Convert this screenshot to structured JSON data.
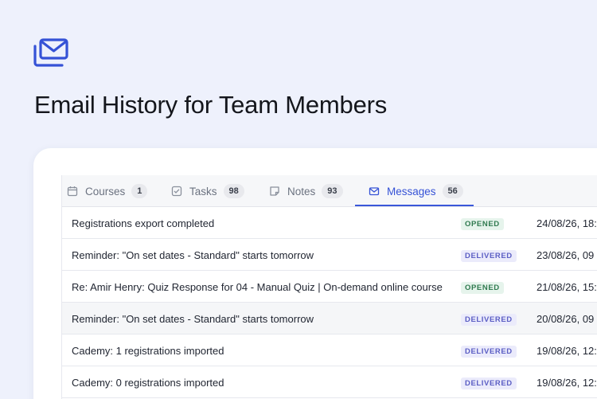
{
  "page": {
    "title": "Email History for Team Members",
    "icon": "mail-stack-icon",
    "accent": "#3a57d9"
  },
  "tabs": [
    {
      "label": "Courses",
      "count": "1",
      "icon": "calendar-icon"
    },
    {
      "label": "Tasks",
      "count": "98",
      "icon": "checkbox-icon"
    },
    {
      "label": "Notes",
      "count": "93",
      "icon": "note-icon"
    },
    {
      "label": "Messages",
      "count": "56",
      "icon": "mail-icon",
      "active": true
    }
  ],
  "messages": [
    {
      "subject": "Registrations export completed",
      "status": "OPENED",
      "date": "24/08/26, 18:"
    },
    {
      "subject": "Reminder: \"On set dates - Standard\" starts tomorrow",
      "status": "DELIVERED",
      "date": "23/08/26, 09"
    },
    {
      "subject": "Re: Amir Henry: Quiz Response for 04 - Manual Quiz | On-demand online course",
      "status": "OPENED",
      "date": "21/08/26, 15:"
    },
    {
      "subject": "Reminder: \"On set dates - Standard\" starts tomorrow",
      "status": "DELIVERED",
      "date": "20/08/26, 09"
    },
    {
      "subject": "Cademy: 1 registrations imported",
      "status": "DELIVERED",
      "date": "19/08/26, 12:"
    },
    {
      "subject": "Cademy: 0 registrations imported",
      "status": "DELIVERED",
      "date": "19/08/26, 12:"
    }
  ],
  "colors": {
    "opened": "#2f7a4f",
    "delivered": "#5b5ec4",
    "background": "#eef1fc"
  }
}
